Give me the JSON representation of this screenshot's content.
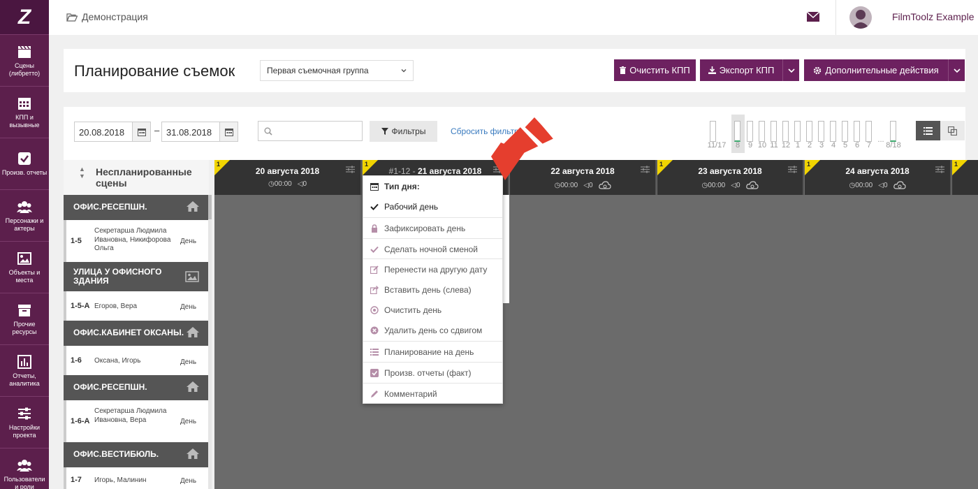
{
  "sidebar": {
    "logo": "Z",
    "items": [
      {
        "label": "Сцены (либретто)",
        "icon": "clapper-icon"
      },
      {
        "label": "КПП и вызывные",
        "icon": "calendar-icon"
      },
      {
        "label": "Произв. отчеты",
        "icon": "checkbox-icon"
      },
      {
        "label": "Персонажи и актеры",
        "icon": "users-icon"
      },
      {
        "label": "Объекты и места",
        "icon": "image-icon"
      },
      {
        "label": "Прочие ресурсы",
        "icon": "archive-icon"
      },
      {
        "label": "Отчеты, аналитика",
        "icon": "bar-chart-icon"
      },
      {
        "label": "Настройки проекта",
        "icon": "sliders-icon"
      },
      {
        "label": "Пользователи и роли",
        "icon": "users-icon"
      }
    ]
  },
  "topbar": {
    "breadcrumb": "Демонстрация",
    "username": "FilmToolz Example"
  },
  "header": {
    "title": "Планирование съемок",
    "group_select": "Первая съемочная группа",
    "clear_button": "Очистить КПП",
    "export_button": "Экспорт КПП",
    "more_button": "Дополнительные действия"
  },
  "toolbar": {
    "date_from": "20.08.2018",
    "date_sep": "–",
    "date_to": "31.08.2018",
    "search_placeholder": "",
    "filters_button": "Фильтры",
    "reset_link": "Сбросить фильтр",
    "mini_chart_labels": [
      "11/17",
      "8",
      "9",
      "10",
      "11",
      "12",
      "1",
      "2",
      "3",
      "4",
      "5",
      "6",
      "7",
      "...",
      "8/18"
    ]
  },
  "unplanned": {
    "title": "Неспланированные сцены",
    "rows": [
      {
        "kind": "location",
        "label": "ОФИС.РЕСЕПШН.",
        "icon": "home-icon"
      },
      {
        "kind": "scene",
        "num": "1-5",
        "cast": "Секретарша Людмила Ивановна, Никифорова Ольга",
        "tod": "День"
      },
      {
        "kind": "location",
        "label": "УЛИЦА У ОФИСНОГО ЗДАНИЯ",
        "icon": "image-icon"
      },
      {
        "kind": "scene",
        "num": "1-5-А",
        "cast": "Егоров, Вера",
        "tod": "День"
      },
      {
        "kind": "location",
        "label": "ОФИС.КАБИНЕТ ОКСАНЫ.",
        "icon": "home-icon"
      },
      {
        "kind": "scene",
        "num": "1-6",
        "cast": "Оксана, Игорь",
        "tod": "День"
      },
      {
        "kind": "location",
        "label": "ОФИС.РЕСЕПШН.",
        "icon": "home-icon"
      },
      {
        "kind": "scene",
        "num": "1-6-А",
        "cast": "Секретарша Людмила Ивановна, Вера",
        "tod": "День"
      },
      {
        "kind": "location",
        "label": "ОФИС.ВЕСТИБЮЛЬ.",
        "icon": "home-icon"
      },
      {
        "kind": "scene",
        "num": "1-7",
        "cast": "Игорь, Малинин",
        "tod": "День"
      }
    ]
  },
  "days": [
    {
      "badge": "1",
      "prefix": "",
      "title": "20 августа 2018",
      "time": "00:00",
      "count": "0",
      "weather": false
    },
    {
      "badge": "1",
      "prefix": "#1-12 - ",
      "title": "21 августа 2018",
      "time": "",
      "count": "",
      "weather": false
    },
    {
      "badge": "",
      "prefix": "",
      "title": "22 августа 2018",
      "time": "00:00",
      "count": "0",
      "weather": true
    },
    {
      "badge": "1",
      "prefix": "",
      "title": "23 августа 2018",
      "time": "00:00",
      "count": "0",
      "weather": true
    },
    {
      "badge": "1",
      "prefix": "",
      "title": "24 августа 2018",
      "time": "00:00",
      "count": "0",
      "weather": true
    },
    {
      "badge": "1",
      "prefix": "",
      "title": "",
      "time": "",
      "count": "",
      "weather": false
    }
  ],
  "context_menu": {
    "header": "Тип дня:",
    "items": [
      {
        "label": "Рабочий день",
        "icon": "check-icon",
        "selected": true
      },
      {
        "label": "Зафиксировать день",
        "icon": "lock-icon"
      },
      {
        "label": "Сделать ночной сменой",
        "icon": "check-icon"
      },
      {
        "label": "Перенести на другую дату",
        "icon": "edit-icon"
      },
      {
        "label": "Вставить день (слева)",
        "icon": "share-icon"
      },
      {
        "label": "Очистить день",
        "icon": "clear-circle-icon"
      },
      {
        "label": "Удалить день со сдвигом",
        "icon": "close-circle-icon"
      },
      {
        "label": "Планирование на день",
        "icon": "list-icon"
      },
      {
        "label": "Произв. отчеты (факт)",
        "icon": "checkbox-icon"
      },
      {
        "label": "Комментарий",
        "icon": "pencil-icon"
      }
    ]
  },
  "colors": {
    "brand": "#6d2160",
    "sidebar": "#5c1f4c",
    "link": "#3a7bbf",
    "badge": "#f1d400",
    "arrow": "#e53e2e"
  }
}
